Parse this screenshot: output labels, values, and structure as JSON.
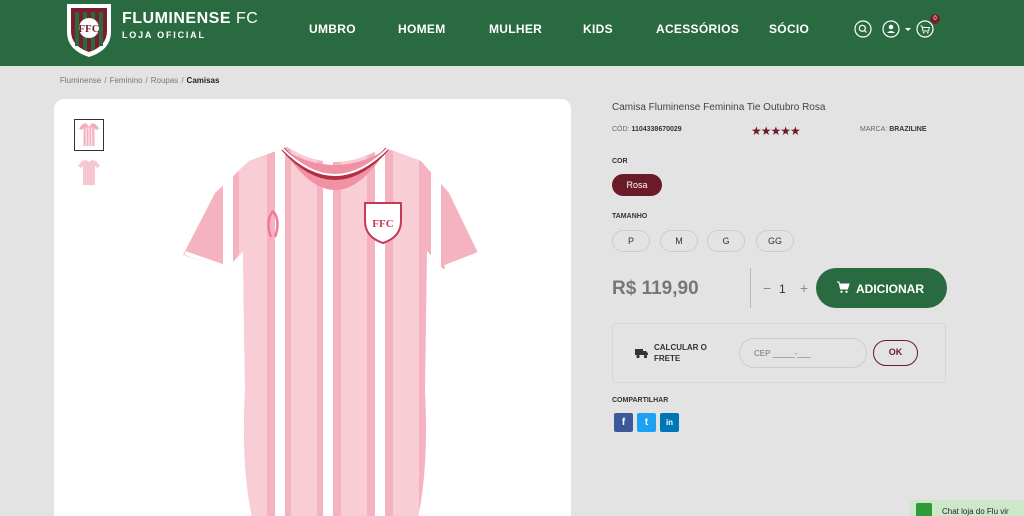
{
  "header": {
    "brand_name": "FLUMINENSE",
    "brand_fc": "FC",
    "brand_sub": "LOJA OFICIAL",
    "nav": [
      "UMBRO",
      "HOMEM",
      "MULHER",
      "KIDS",
      "ACESSÓRIOS",
      "SÓCIO"
    ],
    "cart_count": "0"
  },
  "breadcrumb": {
    "items": [
      "Fluminense",
      "Feminino",
      "Roupas"
    ],
    "current": "Camisas",
    "separator": "/"
  },
  "product": {
    "title": "Camisa Fluminense Feminina Tie Outubro Rosa",
    "code_label": "CÓD:",
    "code": "1104338670029",
    "rating": "★★★★★",
    "brand_label": "MARCA:",
    "brand": "BRAZILINE",
    "color_label": "COR",
    "color": "Rosa",
    "size_label": "TAMANHO",
    "sizes": [
      "P",
      "M",
      "G",
      "GG"
    ],
    "price": "R$ 119,90",
    "qty_minus": "−",
    "qty": "1",
    "qty_plus": "+",
    "add_label": "ADICIONAR"
  },
  "shipping": {
    "label": "CALCULAR O FRETE",
    "placeholder": "CEP _____-___",
    "ok": "OK"
  },
  "share": {
    "label": "COMPARTILHAR",
    "networks": [
      "f",
      "t",
      "in"
    ]
  },
  "chat": {
    "label": "Chat loja do Flu vir"
  },
  "colors": {
    "header_green": "#2a6a40",
    "accent_maroon": "#6b1a28",
    "facebook": "#3b5998",
    "twitter": "#1da1f2",
    "linkedin": "#0077b5"
  }
}
